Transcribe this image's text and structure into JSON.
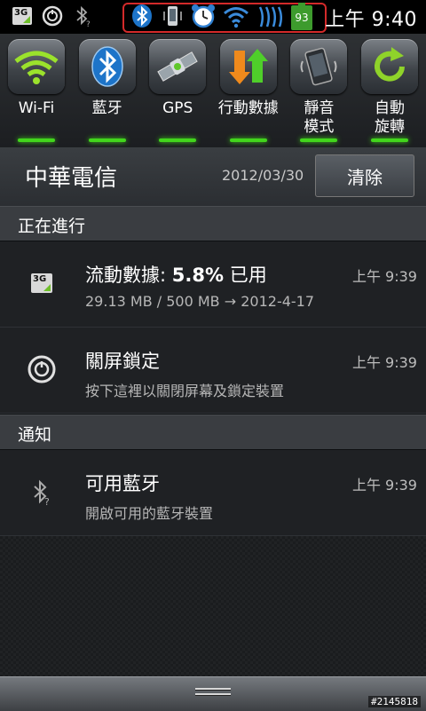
{
  "statusbar": {
    "left_icons": [
      "3g-icon",
      "power-lock-icon",
      "bluetooth-unknown-icon"
    ],
    "highlight_icons": [
      "bluetooth-icon",
      "phone-vibrate-icon",
      "alarm-clock-icon",
      "wifi-icon",
      "signal-icon"
    ],
    "battery_level": "93",
    "time": "上午 9:40",
    "highlight_color": "#d32a2a"
  },
  "toggles": [
    {
      "id": "wifi",
      "label": "Wi-Fi",
      "icon": "wifi-icon",
      "on": true
    },
    {
      "id": "bluetooth",
      "label": "藍牙",
      "icon": "bluetooth-icon",
      "on": true
    },
    {
      "id": "gps",
      "label": "GPS",
      "icon": "satellite-icon",
      "on": true
    },
    {
      "id": "mobile-data",
      "label": "行動數據",
      "icon": "data-arrows-icon",
      "on": true
    },
    {
      "id": "silent",
      "label": "靜音\n模式",
      "icon": "silent-phone-icon",
      "on": true
    },
    {
      "id": "rotate",
      "label": "自動\n旋轉",
      "icon": "rotate-icon",
      "on": true
    }
  ],
  "carrier": {
    "name": "中華電信",
    "date": "2012/03/30",
    "clear_label": "清除"
  },
  "ongoing": {
    "header": "正在進行",
    "items": [
      {
        "title_prefix": "流動數據: ",
        "title_bold": "5.8%",
        "title_suffix": " 已用",
        "subtitle": "29.13 MB / 500 MB → 2012-4-17",
        "time": "上午 9:39",
        "icon": "3g-icon"
      },
      {
        "title": "關屏鎖定",
        "subtitle": "按下這裡以關閉屏幕及鎖定裝置",
        "time": "上午 9:39",
        "icon": "power-lock-icon"
      }
    ]
  },
  "notifications": {
    "header": "通知",
    "items": [
      {
        "title": "可用藍牙",
        "subtitle": "開啟可用的藍牙裝置",
        "time": "上午 9:39",
        "icon": "bluetooth-unknown-icon"
      }
    ]
  },
  "watermark": "#2145818",
  "colors": {
    "accent_green": "#42d51c",
    "battery_green": "#3d9b2d"
  }
}
